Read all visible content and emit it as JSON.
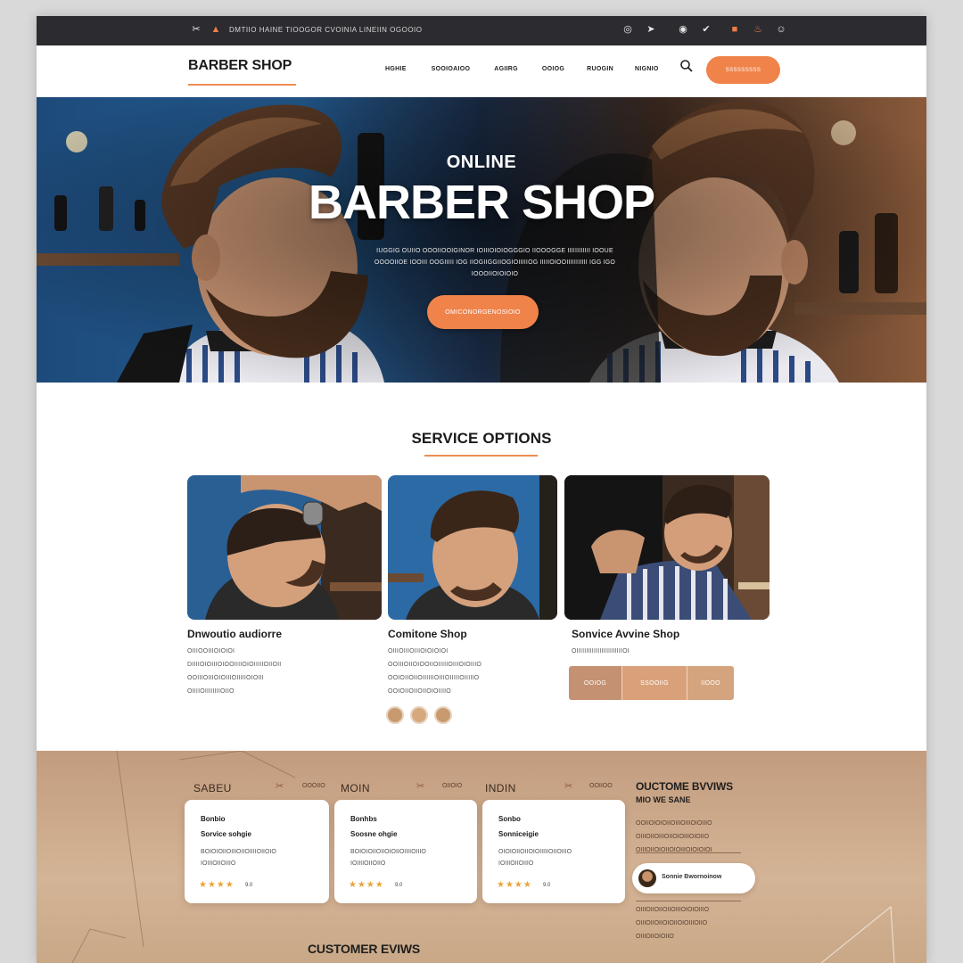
{
  "topbar": {
    "text": "DMTIIO HAINE TIOOGOR CVOINIA LINEIIN OGOOIO",
    "social_icons": [
      "globe-icon",
      "send-icon",
      "instagram-icon",
      "twitter-icon",
      "youtube-icon",
      "fire-icon",
      "chat-icon"
    ]
  },
  "header": {
    "brand": "BARBER SHOP",
    "nav": [
      "HGHIE",
      "SOOIOAIOO",
      "AGIIRG",
      "OOIOG",
      "RUOGIN",
      "NIGNIO"
    ],
    "cta_label": "SSSSSSSSS"
  },
  "hero": {
    "subtitle": "ONLINE",
    "title": "BARBER SHOP",
    "description": "IUGGIG OUIIO OOOIIOOIGINOR IOIIIOIOIOGGGIO IIOOOGGE IIIIIIIIIIII IOOUE OOOOIIOE IOOIII OOGIIIII IOG IIOGIIGGIIOGIOIIIIIOG IIIIIOIOOIIIIIIIIIII IGG IGO IOOOIIOIOIOIO",
    "button_label": "OMICONORGENOSIOIO"
  },
  "services": {
    "title": "SERVICE OPTIONS",
    "cards": [
      {
        "title": "Dnwoutio audiorre",
        "lines": [
          "OIIIOOIIIOIOIOI",
          "DIIIIOIOIIIOIOOIIIIOIOIIIIIOIIOII",
          "OOIIIOIIIOIOIIIOIIIIIOIOIII",
          "OIIIIOIIIIIIIIOIIO"
        ]
      },
      {
        "title": "Comitone Shop",
        "lines": [
          "OIIIOIIIOIIIOIOIOIOI",
          "OOIIIOIIOIOOIIOIIIIIOIIIOIOIIIO",
          "OOIOIIOIIOIIIIIIOIIIOIIIIIOIIIIIO",
          "OOIOIIOIIOIIOIOIIIIO"
        ]
      },
      {
        "title": "Sonvice Avvine Shop",
        "lines": [
          "OIIIIIIIIIIIIIIIIIIIIIIIIOI"
        ]
      }
    ],
    "segment_buttons": [
      "OOIOG",
      "SSOOIIG",
      "IIOOO"
    ]
  },
  "reviews": {
    "tabs": [
      {
        "label": "SABEU",
        "meta": ""
      },
      {
        "label": "MOIN",
        "meta": "OOOIIO"
      },
      {
        "label": "INDIN",
        "meta": "OIIOIO"
      },
      {
        "label": "",
        "meta": "OOIIOO"
      }
    ],
    "cards": [
      {
        "name": "Bonbio",
        "service": "Sorvice sohgie",
        "lines": [
          "BOIOIOIIOIIIOIIOIIIIOIIOIO",
          "IOIIIOIIOIIIO"
        ],
        "stars": "★★★★",
        "score": "9.0"
      },
      {
        "name": "Bonhbs",
        "service": "Soosne ohgie",
        "lines": [
          "BOIOIOIIOIIOIOIIOIIIIOIIIO",
          "IOIIIIOIIOIIO"
        ],
        "stars": "★★★★",
        "score": "9.0"
      },
      {
        "name": "Sonbo",
        "service": "Sonniceigie",
        "lines": [
          "OIOIOIIOIIOIOIIIIIOIIOIIIO",
          "IOIIIOIIOIIIO"
        ],
        "stars": "★★★★",
        "score": "9.0"
      }
    ],
    "side": {
      "title": "OUCTOME BVVIWS",
      "subtitle": "MIO WE SANE",
      "text_1": [
        "OOIIOIOIOIIOIIIOIIIOIOIIIO",
        "OIIIOIIOIIIOIIOIOIIIOIOIIO",
        "OIIIOIIOIOIIOIOIIIOIOIOIOI"
      ],
      "pill_text": "Sonnie Bwornoinow",
      "text_2": [
        "OIIIOIIOIIOIIOIIIOIOIOIIIO",
        "OIIIOIIOIIOIOIIOIOIIIOIIO",
        "OIIIOIIOIOIIO"
      ]
    },
    "bottom_title": "CUSTOMER EVIWS"
  }
}
